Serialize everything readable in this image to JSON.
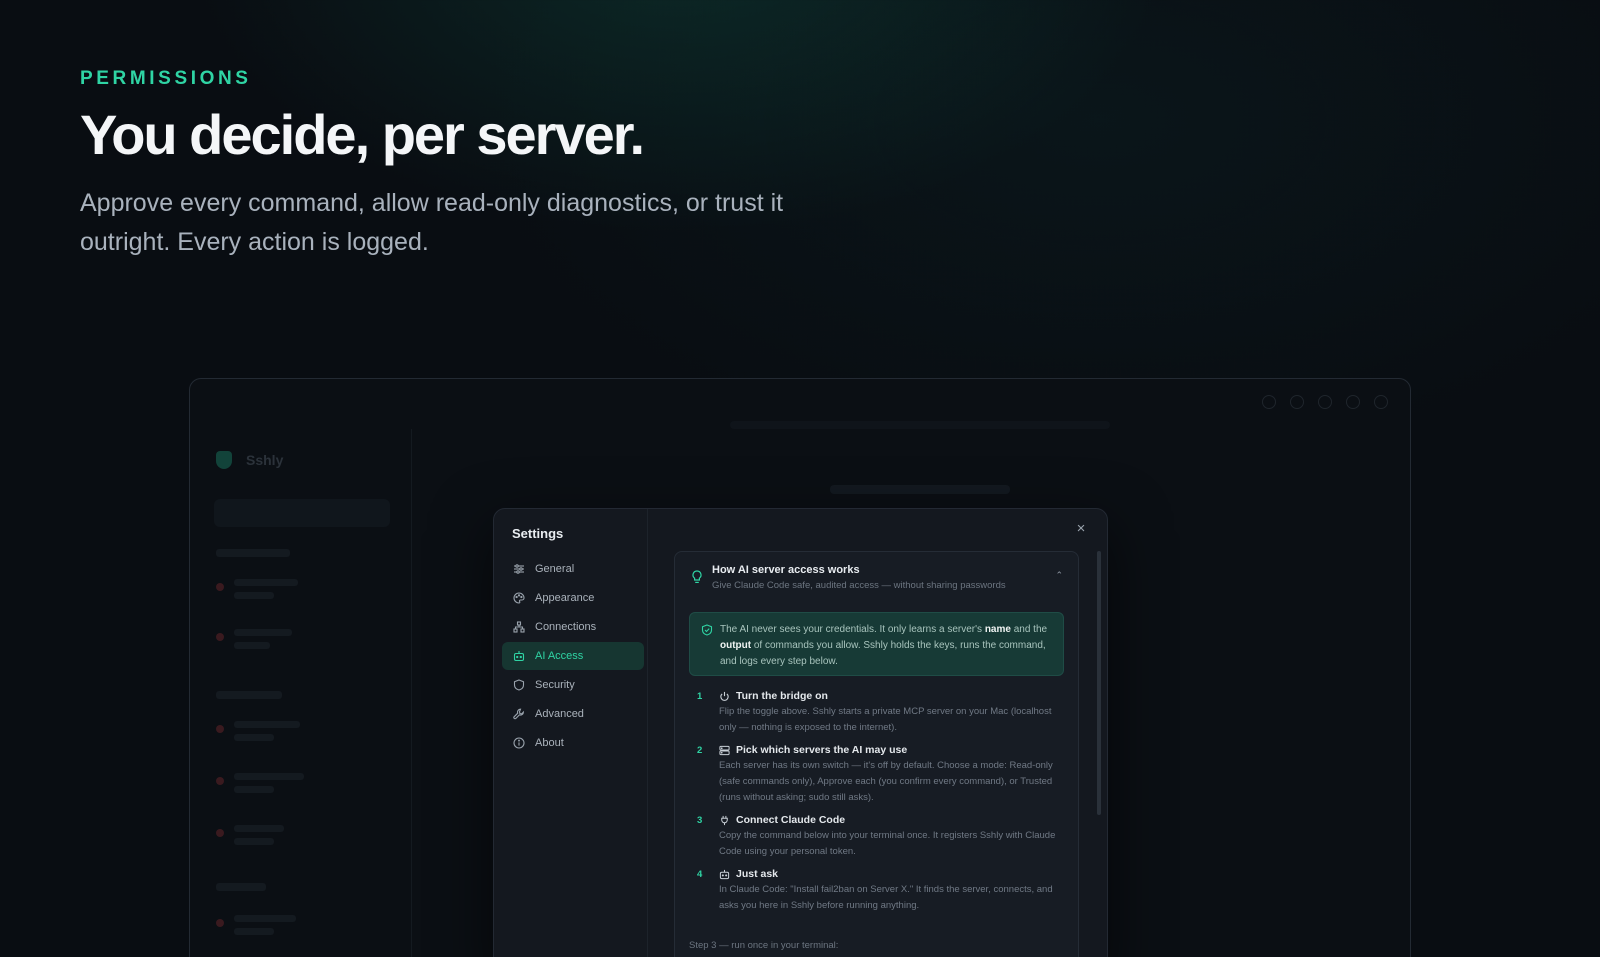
{
  "hero": {
    "eyebrow": "PERMISSIONS",
    "headline": "You decide, per server.",
    "lede": "Approve every command, allow read-only diagnostics, or trust it outright. Every action is logged."
  },
  "app": {
    "brand": "Sshly"
  },
  "settings": {
    "title": "Settings",
    "close_label": "×",
    "nav": [
      {
        "label": "General",
        "icon": "sliders-icon"
      },
      {
        "label": "Appearance",
        "icon": "palette-icon"
      },
      {
        "label": "Connections",
        "icon": "network-icon"
      },
      {
        "label": "AI Access",
        "icon": "robot-icon"
      },
      {
        "label": "Security",
        "icon": "shield-icon"
      },
      {
        "label": "Advanced",
        "icon": "wrench-icon"
      },
      {
        "label": "About",
        "icon": "info-icon"
      }
    ],
    "active_nav": "AI Access",
    "panel": {
      "title": "How AI server access works",
      "subtitle": "Give Claude Code safe, audited access — without sharing passwords",
      "callout": {
        "before_name": "The AI never sees your credentials. It only learns a server's",
        "name_word": "name",
        "between": "and the",
        "output_word": "output",
        "after": "of commands you allow. Sshly holds the keys, runs the command, and logs every step below."
      },
      "steps": [
        {
          "num": "1",
          "title": "Turn the bridge on",
          "icon": "power-icon",
          "body": "Flip the toggle above. Sshly starts a private MCP server on your Mac (localhost only — nothing is exposed to the internet)."
        },
        {
          "num": "2",
          "title": "Pick which servers the AI may use",
          "icon": "server-icon",
          "body": "Each server has its own switch — it's off by default. Choose a mode: Read-only (safe commands only), Approve each (you confirm every command), or Trusted (runs without asking; sudo still asks)."
        },
        {
          "num": "3",
          "title": "Connect Claude Code",
          "icon": "plug-icon",
          "body": "Copy the command below into your terminal once. It registers Sshly with Claude Code using your personal token."
        },
        {
          "num": "4",
          "title": "Just ask",
          "icon": "robot-icon",
          "body": "In Claude Code: \"Install fail2ban on Server X.\" It finds the server, connects, and asks you here in Sshly before running anything."
        }
      ],
      "command_label": "Step 3 — run once in your terminal:"
    }
  },
  "colors": {
    "accent": "#2fd4a4",
    "background": "#090d12",
    "modal": "#14181f"
  }
}
